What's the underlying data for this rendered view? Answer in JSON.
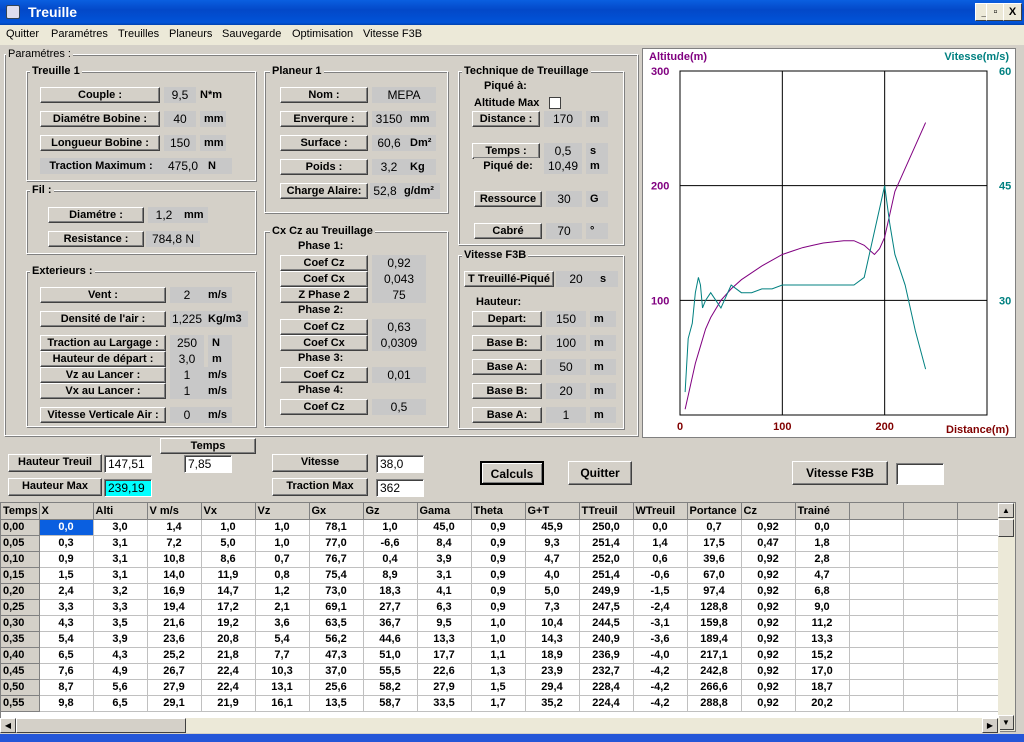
{
  "window": {
    "title": "Treuille",
    "buttons": {
      "minimize": "_",
      "maximize": "▫",
      "close": "X"
    }
  },
  "menu": [
    "Quitter",
    "Paramétres",
    "Treuilles",
    "Planeurs",
    "Sauvegarde",
    "Optimisation",
    "Vitesse F3B"
  ],
  "params_title": "Paramétres :",
  "treuille1": {
    "title": "Treuille 1",
    "couple": {
      "label": "Couple :",
      "value": "9,5",
      "unit": "N*m"
    },
    "diametre_bobine": {
      "label": "Diamétre Bobine :",
      "value": "40",
      "unit": "mm"
    },
    "longueur_bobine": {
      "label": "Longueur Bobine :",
      "value": "150",
      "unit": "mm"
    },
    "traction_max": {
      "label": "Traction Maximum :",
      "value": "475,0",
      "unit": "N"
    }
  },
  "fil": {
    "title": "Fil :",
    "diametre": {
      "label": "Diamétre :",
      "value": "1,2",
      "unit": "mm"
    },
    "resistance": {
      "label": "Resistance :",
      "value": "784,8 N"
    }
  },
  "exterieurs": {
    "title": "Exterieurs :",
    "vent": {
      "label": "Vent :",
      "value": "2",
      "unit": "m/s"
    },
    "densite": {
      "label": "Densité de l'air :",
      "value": "1,225",
      "unit": "Kg/m3"
    },
    "traction_largage": {
      "label": "Traction au Largage :",
      "value": "250",
      "unit": "N"
    },
    "hauteur_depart": {
      "label": "Hauteur de départ :",
      "value": "3,0",
      "unit": "m"
    },
    "vz_lancer": {
      "label": "Vz au Lancer :",
      "value": "1",
      "unit": "m/s"
    },
    "vx_lancer": {
      "label": "Vx au Lancer :",
      "value": "1",
      "unit": "m/s"
    },
    "vitesse_verticale": {
      "label": "Vitesse Verticale Air :",
      "value": "0",
      "unit": "m/s"
    }
  },
  "planeur1": {
    "title": "Planeur 1",
    "nom": {
      "label": "Nom :",
      "value": "MEPA"
    },
    "envergure": {
      "label": "Enverqure :",
      "value": "3150",
      "unit": "mm"
    },
    "surface": {
      "label": "Surface :",
      "value": "60,6",
      "unit": "Dm²"
    },
    "poids": {
      "label": "Poids :",
      "value": "3,2",
      "unit": "Kg"
    },
    "charge_alaire": {
      "label": "Charge Alaire:",
      "value": "52,8",
      "unit": "g/dm²"
    }
  },
  "cxcz": {
    "title": "Cx Cz au Treuillage",
    "phase1": "Phase 1:",
    "coef_cz1": {
      "label": "Coef Cz",
      "value": "0,92"
    },
    "coef_cx1": {
      "label": "Coef Cx",
      "value": "0,043"
    },
    "z_phase2": {
      "label": "Z Phase 2",
      "value": "75"
    },
    "phase2": "Phase 2:",
    "coef_cz2": {
      "label": "Coef Cz",
      "value": "0,63"
    },
    "coef_cx2": {
      "label": "Coef Cx",
      "value": "0,0309"
    },
    "phase3": "Phase 3:",
    "coef_cz3": {
      "label": "Coef Cz",
      "value": "0,01"
    },
    "phase4": "Phase 4:",
    "coef_cz4": {
      "label": "Coef Cz",
      "value": "0,5"
    }
  },
  "technique": {
    "title": "Technique de Treuillage",
    "pique_a": "Piqué à:",
    "altitude_max": "Altitude Max",
    "distance": {
      "label": "Distance :",
      "value": "170",
      "unit": "m"
    },
    "temps": {
      "label": "Temps :",
      "value": "0,5",
      "unit": "s"
    },
    "pique_de": {
      "label": "Piqué de:",
      "value": "10,49",
      "unit": "m"
    },
    "ressource": {
      "label": "Ressource",
      "value": "30",
      "unit": "G"
    },
    "cabre": {
      "label": "Cabré",
      "value": "70",
      "unit": "°"
    }
  },
  "vitesse_f3b": {
    "title": "Vitesse F3B",
    "t_treuille": {
      "label": "T Treuillé-Piqué",
      "value": "20",
      "unit": "s"
    },
    "hauteur": "Hauteur:",
    "depart": {
      "label": "Depart:",
      "value": "150",
      "unit": "m"
    },
    "base_b1": {
      "label": "Base B:",
      "value": "100",
      "unit": "m"
    },
    "base_a1": {
      "label": "Base A:",
      "value": "50",
      "unit": "m"
    },
    "base_b2": {
      "label": "Base B:",
      "value": "20",
      "unit": "m"
    },
    "base_a2": {
      "label": "Base A:",
      "value": "1",
      "unit": "m"
    }
  },
  "results": {
    "hauteur_treuil": {
      "label": "Hauteur Treuil",
      "value": "147,51"
    },
    "temps": {
      "label": "Temps",
      "value": "7,85"
    },
    "vitesse": {
      "label": "Vitesse",
      "value": "38,0"
    },
    "hauteur_max": {
      "label": "Hauteur Max",
      "value": "239,19"
    },
    "traction_max": {
      "label": "Traction  Max",
      "value": "362"
    },
    "calculs": "Calculs",
    "quitter": "Quitter",
    "vitesse_f3b_btn": "Vitesse F3B",
    "vitesse_f3b_value": ""
  },
  "chart_data": {
    "type": "line",
    "y_left_label": "Altitude(m)",
    "y_right_label": "Vitesse(m/s)",
    "xlabel": "Distance(m)",
    "x_ticks": [
      "0",
      "100",
      "200"
    ],
    "y_left_ticks": [
      "100",
      "200",
      "300"
    ],
    "y_right_ticks": [
      "30",
      "45",
      "60"
    ],
    "xlim": [
      0,
      300
    ],
    "ylim_left": [
      0,
      300
    ],
    "ylim_right": [
      15,
      60
    ],
    "grid": true,
    "colors": {
      "altitude": "#800080",
      "vitesse": "#008080"
    },
    "series": [
      {
        "axis": "left",
        "x": [
          5,
          10,
          15,
          20,
          25,
          30,
          40,
          50,
          60,
          70,
          80,
          90,
          100,
          110,
          120,
          130,
          140,
          150,
          160,
          170,
          180,
          190,
          195,
          200,
          205,
          210,
          215,
          220,
          230,
          240
        ],
        "y": [
          5,
          25,
          45,
          60,
          75,
          85,
          100,
          110,
          118,
          124,
          130,
          135,
          140,
          143,
          146,
          148,
          150,
          151,
          152,
          152,
          148,
          140,
          145,
          155,
          175,
          195,
          205,
          215,
          235,
          255
        ]
      },
      {
        "axis": "right",
        "x": [
          5,
          8,
          12,
          15,
          18,
          20,
          22,
          25,
          30,
          35,
          40,
          50,
          60,
          70,
          80,
          90,
          100,
          120,
          140,
          160,
          170,
          180,
          190,
          195,
          200,
          205,
          210,
          220,
          230,
          240
        ],
        "y": [
          18,
          25,
          27,
          31,
          33,
          32,
          29,
          30,
          31,
          30,
          29,
          32,
          31,
          31,
          31.5,
          31.5,
          32,
          32,
          32,
          32,
          32,
          33,
          39,
          42,
          45,
          40,
          36,
          32,
          26,
          21
        ]
      }
    ]
  },
  "table": {
    "columns": [
      "Temps",
      "X",
      "Alti",
      "V m/s",
      "Vx",
      "Vz",
      "Gx",
      "Gz",
      "Gama",
      "Theta",
      "G+T",
      "TTreuil",
      "WTreuil",
      "Portance",
      "Cz",
      "Trainé",
      "",
      "",
      ""
    ],
    "rows": [
      [
        "0,00",
        "0,0",
        "3,0",
        "1,4",
        "1,0",
        "1,0",
        "78,1",
        "1,0",
        "45,0",
        "0,9",
        "45,9",
        "250,0",
        "0,0",
        "0,7",
        "0,92",
        "0,0"
      ],
      [
        "0,05",
        "0,3",
        "3,1",
        "7,2",
        "5,0",
        "1,0",
        "77,0",
        "-6,6",
        "8,4",
        "0,9",
        "9,3",
        "251,4",
        "1,4",
        "17,5",
        "0,47",
        "1,8"
      ],
      [
        "0,10",
        "0,9",
        "3,1",
        "10,8",
        "8,6",
        "0,7",
        "76,7",
        "0,4",
        "3,9",
        "0,9",
        "4,7",
        "252,0",
        "0,6",
        "39,6",
        "0,92",
        "2,8"
      ],
      [
        "0,15",
        "1,5",
        "3,1",
        "14,0",
        "11,9",
        "0,8",
        "75,4",
        "8,9",
        "3,1",
        "0,9",
        "4,0",
        "251,4",
        "-0,6",
        "67,0",
        "0,92",
        "4,7"
      ],
      [
        "0,20",
        "2,4",
        "3,2",
        "16,9",
        "14,7",
        "1,2",
        "73,0",
        "18,3",
        "4,1",
        "0,9",
        "5,0",
        "249,9",
        "-1,5",
        "97,4",
        "0,92",
        "6,8"
      ],
      [
        "0,25",
        "3,3",
        "3,3",
        "19,4",
        "17,2",
        "2,1",
        "69,1",
        "27,7",
        "6,3",
        "0,9",
        "7,3",
        "247,5",
        "-2,4",
        "128,8",
        "0,92",
        "9,0"
      ],
      [
        "0,30",
        "4,3",
        "3,5",
        "21,6",
        "19,2",
        "3,6",
        "63,5",
        "36,7",
        "9,5",
        "1,0",
        "10,4",
        "244,5",
        "-3,1",
        "159,8",
        "0,92",
        "11,2"
      ],
      [
        "0,35",
        "5,4",
        "3,9",
        "23,6",
        "20,8",
        "5,4",
        "56,2",
        "44,6",
        "13,3",
        "1,0",
        "14,3",
        "240,9",
        "-3,6",
        "189,4",
        "0,92",
        "13,3"
      ],
      [
        "0,40",
        "6,5",
        "4,3",
        "25,2",
        "21,8",
        "7,7",
        "47,3",
        "51,0",
        "17,7",
        "1,1",
        "18,9",
        "236,9",
        "-4,0",
        "217,1",
        "0,92",
        "15,2"
      ],
      [
        "0,45",
        "7,6",
        "4,9",
        "26,7",
        "22,4",
        "10,3",
        "37,0",
        "55,5",
        "22,6",
        "1,3",
        "23,9",
        "232,7",
        "-4,2",
        "242,8",
        "0,92",
        "17,0"
      ],
      [
        "0,50",
        "8,7",
        "5,6",
        "27,9",
        "22,4",
        "13,1",
        "25,6",
        "58,2",
        "27,9",
        "1,5",
        "29,4",
        "228,4",
        "-4,2",
        "266,6",
        "0,92",
        "18,7"
      ],
      [
        "0,55",
        "9,8",
        "6,5",
        "29,1",
        "21,9",
        "16,1",
        "13,5",
        "58,7",
        "33,5",
        "1,7",
        "35,2",
        "224,4",
        "-4,2",
        "288,8",
        "0,92",
        "20,2"
      ]
    ]
  }
}
